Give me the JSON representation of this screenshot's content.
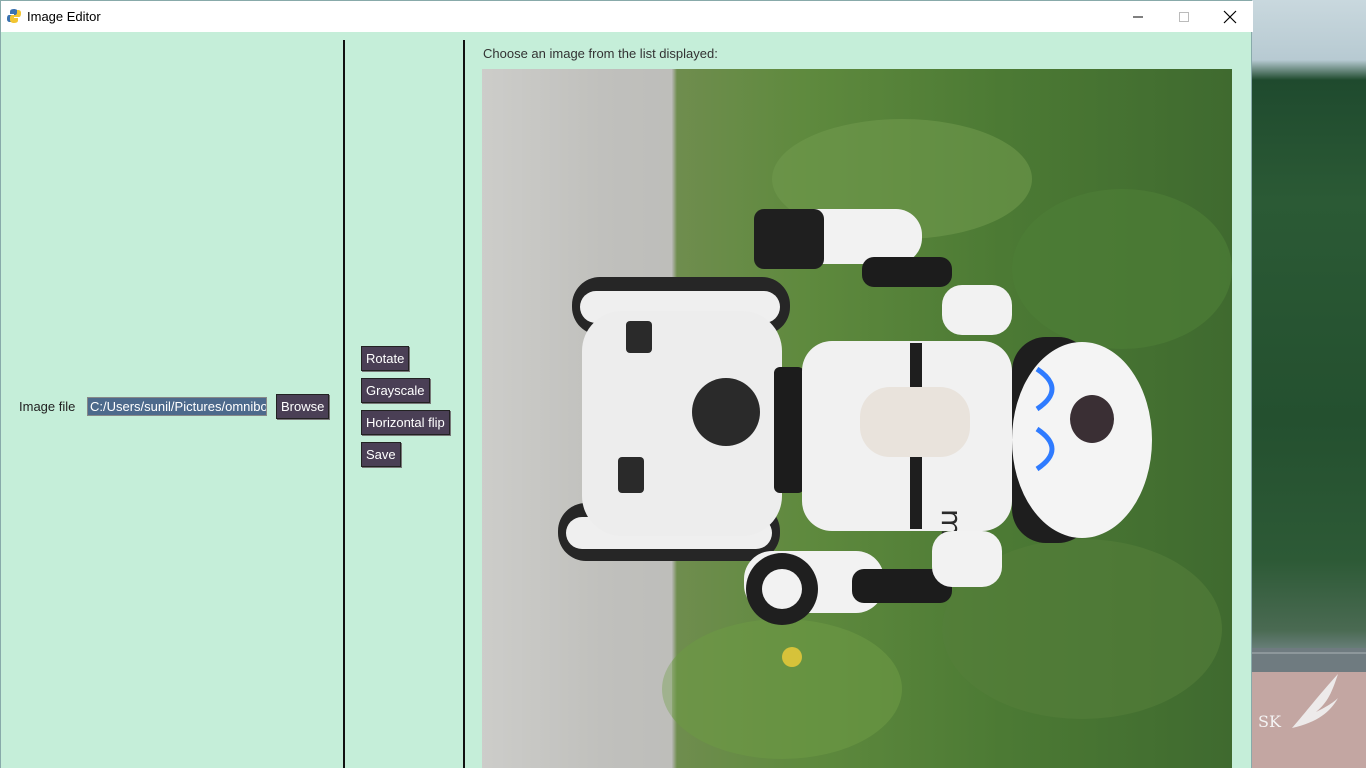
{
  "window": {
    "title": "Image Editor",
    "controls": {
      "minimize": "minimize-icon",
      "maximize": "maximize-icon",
      "close": "close-icon"
    }
  },
  "left_panel": {
    "image_file_label": "Image file",
    "image_file_value": "C:/Users/sunil/Pictures/omnibot",
    "browse_label": "Browse"
  },
  "tools": {
    "rotate_label": "Rotate",
    "grayscale_label": "Grayscale",
    "flip_label": "Horizontal flip",
    "save_label": "Save"
  },
  "viewer": {
    "prompt": "Choose an image from the list displayed:",
    "image_subject": "white robot on wheels (Mip) against grass and pavement"
  },
  "desktop": {
    "watermark": "SK"
  },
  "colors": {
    "window_bg": "#c5eed9",
    "button_bg": "#4a3f55",
    "selection_bg": "#4d6a8c"
  }
}
